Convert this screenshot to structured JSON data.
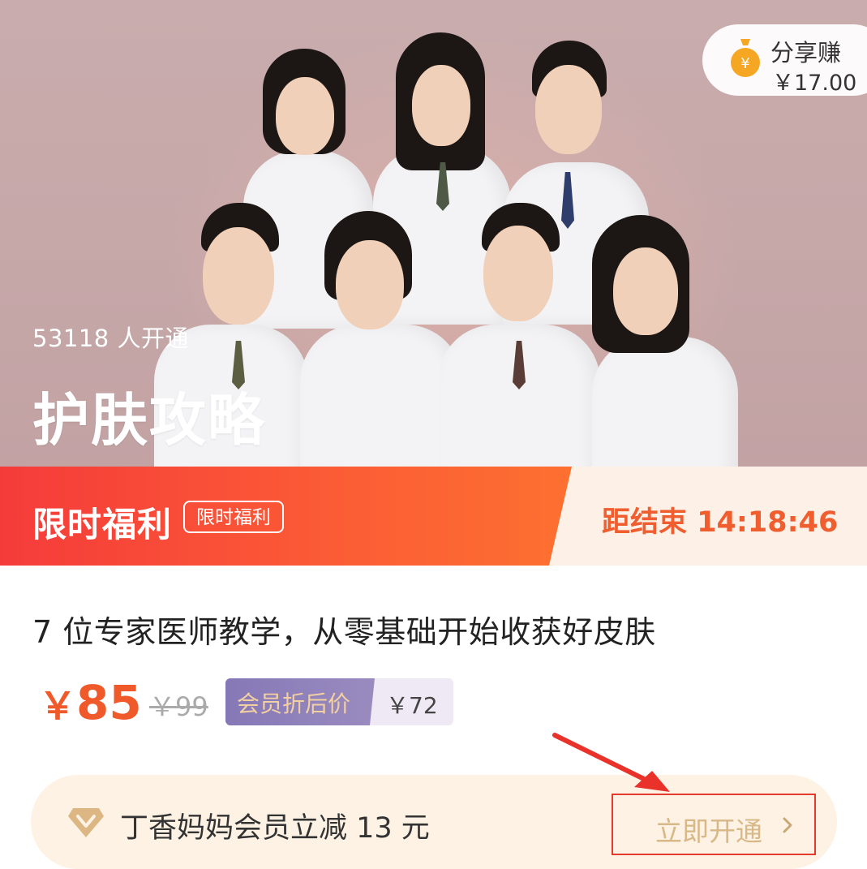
{
  "hero": {
    "enrolled_text": "53118 人开通",
    "title": "护肤攻略",
    "share": {
      "label": "分享赚",
      "amount": "￥17.00"
    }
  },
  "promo": {
    "title": "限时福利",
    "tag": "限时福利",
    "countdown": "距结束 14:18:46"
  },
  "course": {
    "description": "7 位专家医师教学，从零基础开始收获好皮肤",
    "price_symbol": "￥",
    "price_value": "85",
    "original_price": "￥99",
    "member_label": "会员折后价",
    "member_price": "￥72"
  },
  "membership": {
    "text": "丁香妈妈会员立减 13 元",
    "button_label": "立即开通"
  },
  "colors": {
    "accent": "#f05a2a",
    "promo_start": "#f53b3a",
    "promo_end": "#fd7030",
    "member_purple": "#8578b6",
    "member_gold": "#d8b887",
    "highlight_red": "#e63a2f"
  },
  "icons": [
    "money-bag-icon",
    "diamond-icon",
    "chevron-right-icon",
    "red-arrow-annotation"
  ]
}
